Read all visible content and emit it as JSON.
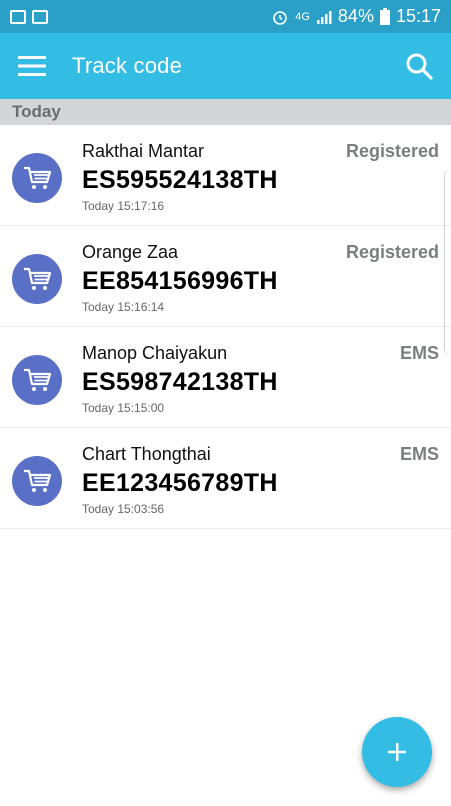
{
  "status_bar": {
    "signal": "4G",
    "battery": "84%",
    "time": "15:17",
    "icons": [
      "image-icon",
      "mail-icon",
      "alarm-icon",
      "signal-icon",
      "battery-icon"
    ]
  },
  "app_bar": {
    "title": "Track code",
    "menu_icon": "menu-icon",
    "search_icon": "search-icon"
  },
  "section": {
    "header": "Today"
  },
  "items": [
    {
      "name": "Rakthai Mantar",
      "code": "ES595524138TH",
      "time": "Today 15:17:16",
      "type": "Registered",
      "icon": "cart-icon"
    },
    {
      "name": "Orange Zaa",
      "code": "EE854156996TH",
      "time": "Today 15:16:14",
      "type": "Registered",
      "icon": "cart-icon"
    },
    {
      "name": "Manop Chaiyakun",
      "code": "ES598742138TH",
      "time": "Today 15:15:00",
      "type": "EMS",
      "icon": "cart-icon"
    },
    {
      "name": "Chart Thongthai",
      "code": "EE123456789TH",
      "time": "Today 15:03:56",
      "type": "EMS",
      "icon": "cart-icon"
    }
  ],
  "fab": {
    "icon": "plus-icon"
  },
  "colors": {
    "status_bar": "#2aa0c9",
    "app_bar": "#33bde5",
    "avatar": "#5a6fc6",
    "section_header": "#d3d6d8"
  }
}
